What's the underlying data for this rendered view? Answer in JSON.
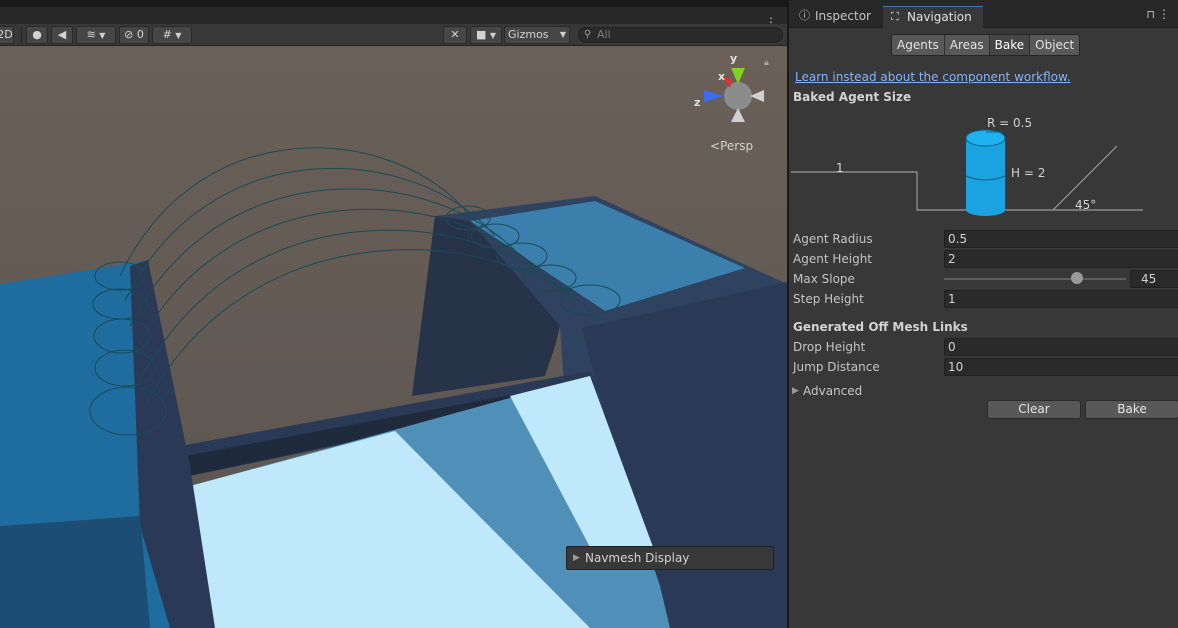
{
  "scene": {
    "toolbar": {
      "btn_2d": "2D",
      "hidden_count": "0",
      "gizmos": "Gizmos",
      "search_placeholder": "All"
    },
    "gizmo_axes": {
      "y": "y",
      "x": "x",
      "z": "z"
    },
    "persp": "Persp",
    "navmesh_display": "Navmesh Display"
  },
  "panel": {
    "tabs": [
      {
        "label": "Inspector",
        "icon": "info-icon"
      },
      {
        "label": "Navigation",
        "icon": "navigation-icon"
      }
    ],
    "segments": [
      "Agents",
      "Areas",
      "Bake",
      "Object"
    ],
    "active_segment": "Bake",
    "learn_link": "Learn instead about the component workflow.",
    "baked_agent_size": {
      "title": "Baked Agent Size",
      "r_label": "R = 0.5",
      "h_label": "H = 2",
      "step_label": "1",
      "slope_label": "45°"
    },
    "fields": {
      "agent_radius": {
        "label": "Agent Radius",
        "value": "0.5"
      },
      "agent_height": {
        "label": "Agent Height",
        "value": "2"
      },
      "max_slope": {
        "label": "Max Slope",
        "value": "45",
        "max": 60
      },
      "step_height": {
        "label": "Step Height",
        "value": "1"
      }
    },
    "offmesh": {
      "title": "Generated Off Mesh Links",
      "drop_height": {
        "label": "Drop Height",
        "value": "0"
      },
      "jump_distance": {
        "label": "Jump Distance",
        "value": "10"
      }
    },
    "advanced": "Advanced",
    "clear": "Clear",
    "bake": "Bake"
  },
  "colors": {
    "accent": "#3a79bb",
    "link": "#81b4ff",
    "navmesh": "#1aa3e0"
  }
}
